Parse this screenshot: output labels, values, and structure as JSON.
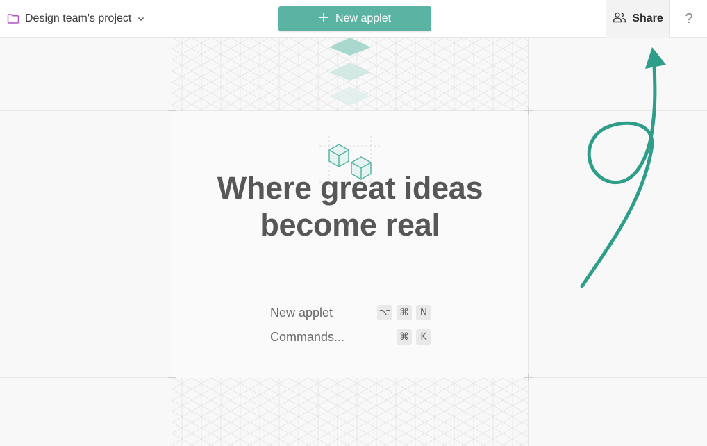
{
  "header": {
    "project_name": "Design team's project",
    "project_icon": "folder-icon",
    "dropdown_icon": "chevron-down-icon",
    "new_applet_label": "New applet",
    "share_label": "Share",
    "share_icon": "users-icon",
    "help_label": "?"
  },
  "main": {
    "headline_line1": "Where great ideas",
    "headline_line2": "become real",
    "illustration_icon": "cubes-icon",
    "shortcuts": [
      {
        "label": "New applet",
        "keys": [
          "⌥",
          "⌘",
          "N"
        ]
      },
      {
        "label": "Commands...",
        "keys": [
          "⌘",
          "K"
        ]
      }
    ]
  },
  "colors": {
    "accent": "#5bb3a3",
    "arrow": "#2e9e8a",
    "folder": "#b452c9"
  }
}
